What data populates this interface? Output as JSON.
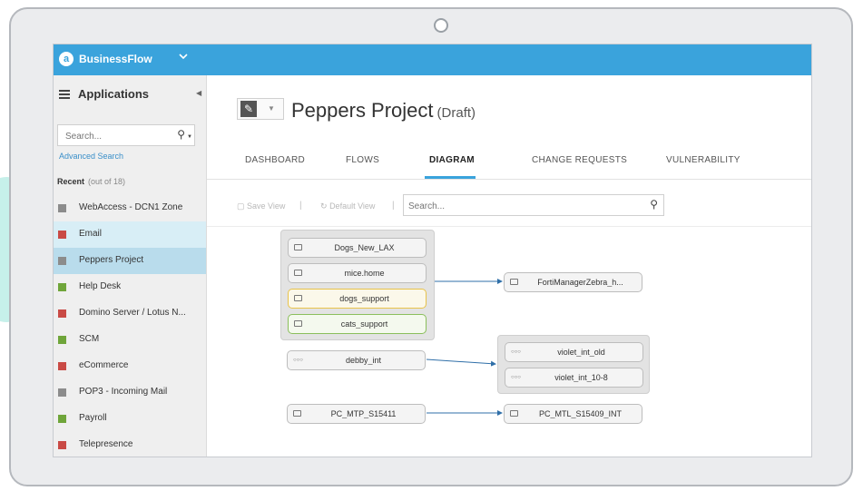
{
  "app": {
    "name": "BusinessFlow",
    "logo_letter": "a"
  },
  "sidebar": {
    "title": "Applications",
    "search_placeholder": "Search...",
    "advanced_search": "Advanced Search",
    "recent_label": "Recent",
    "recent_count": "(out of 18)",
    "items": [
      {
        "label": "WebAccess - DCN1 Zone",
        "color": "#8c8c8c"
      },
      {
        "label": "Email",
        "color": "#c94a45"
      },
      {
        "label": "Peppers Project",
        "color": "#8c8c8c"
      },
      {
        "label": "Help Desk",
        "color": "#6fa53a"
      },
      {
        "label": "Domino Server / Lotus N...",
        "color": "#c94a45"
      },
      {
        "label": "SCM",
        "color": "#6fa53a"
      },
      {
        "label": "eCommerce",
        "color": "#c94a45"
      },
      {
        "label": "POP3 - Incoming Mail",
        "color": "#8c8c8c"
      },
      {
        "label": "Payroll",
        "color": "#6fa53a"
      },
      {
        "label": "Telepresence",
        "color": "#c94a45"
      }
    ]
  },
  "header": {
    "title": "Peppers Project",
    "status": "(Draft)"
  },
  "tabs": [
    {
      "label": "DASHBOARD"
    },
    {
      "label": "FLOWS"
    },
    {
      "label": "DIAGRAM"
    },
    {
      "label": "CHANGE REQUESTS"
    },
    {
      "label": "VULNERABILITY"
    }
  ],
  "toolbar": {
    "save_view": "Save View",
    "default_view": "Default View",
    "search_placeholder": "Search..."
  },
  "diagram": {
    "group1": [
      "Dogs_New_LAX",
      "mice.home",
      "dogs_support",
      "cats_support"
    ],
    "fortimanager": "FortiManagerZebra_h...",
    "debby": "debby_int",
    "violet_group": [
      "violet_int_old",
      "violet_int_10-8"
    ],
    "pc_mtp": "PC_MTP_S15411",
    "pc_mtl": "PC_MTL_S15409_INT"
  },
  "colors": {
    "accent": "#3aa3dc"
  }
}
